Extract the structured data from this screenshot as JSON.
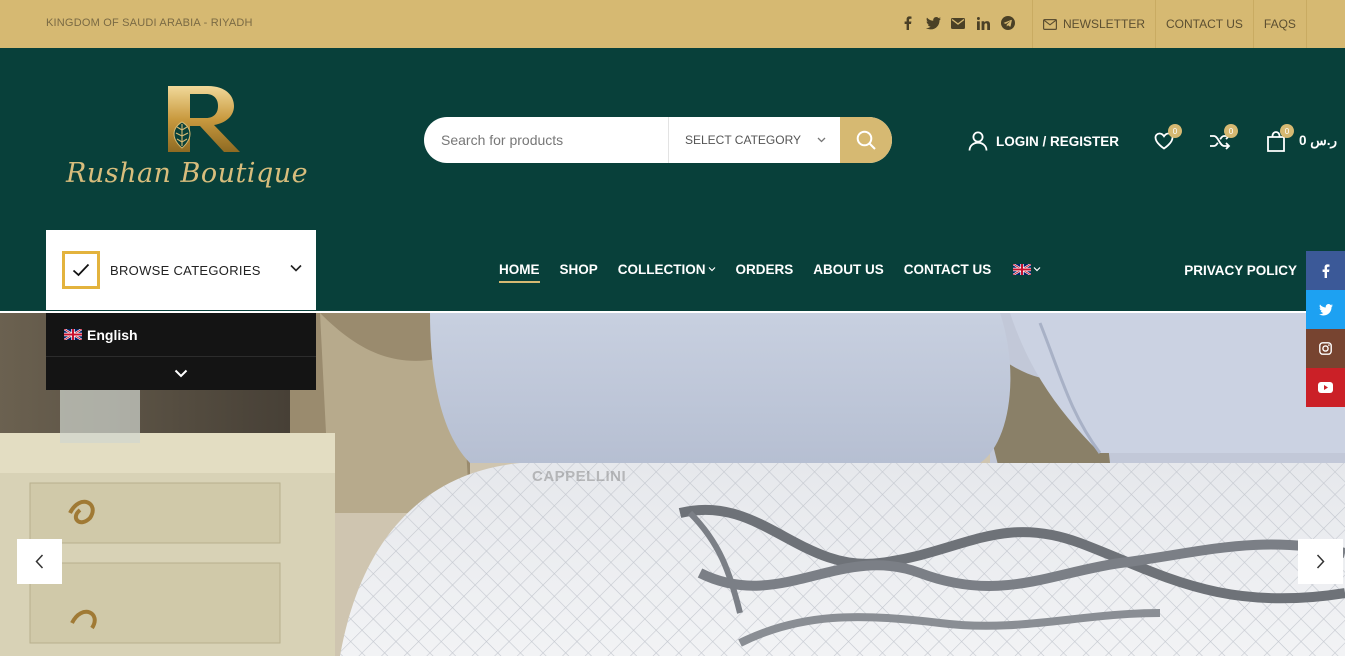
{
  "topbar": {
    "location": "KINGDOM OF SAUDI ARABIA - RIYADH",
    "social_icons": [
      "facebook-icon",
      "twitter-icon",
      "mail-icon",
      "linkedin-icon",
      "telegram-icon"
    ],
    "links": {
      "newsletter": "NEWSLETTER",
      "contact": "CONTACT US",
      "faqs": "FAQS"
    }
  },
  "logo": {
    "monogram": "R",
    "brand": "Rushan Boutique"
  },
  "search": {
    "placeholder": "Search for products",
    "category_label": "SELECT CATEGORY"
  },
  "header_actions": {
    "login_label": "LOGIN / REGISTER",
    "wishlist_count": "0",
    "compare_count": "0",
    "cart_count": "0",
    "cart_total": "0 ر.س"
  },
  "browse": {
    "label": "BROWSE CATEGORIES"
  },
  "nav": {
    "home": "HOME",
    "shop": "SHOP",
    "collection": "COLLECTION",
    "orders": "ORDERS",
    "about": "ABOUT US",
    "contact": "CONTACT US",
    "privacy": "PRIVACY POLICY"
  },
  "language_dropdown": {
    "option": "English"
  },
  "hero": {
    "watermark": "CAPPELLINI"
  },
  "floating_social": [
    "facebook-icon",
    "twitter-icon",
    "instagram-icon",
    "youtube-icon"
  ],
  "colors": {
    "gold": "#d6b972",
    "dark_green": "#08403a",
    "facebook": "#3b5998",
    "twitter": "#1da1f2",
    "instagram": "#774430",
    "youtube": "#cb2027"
  }
}
